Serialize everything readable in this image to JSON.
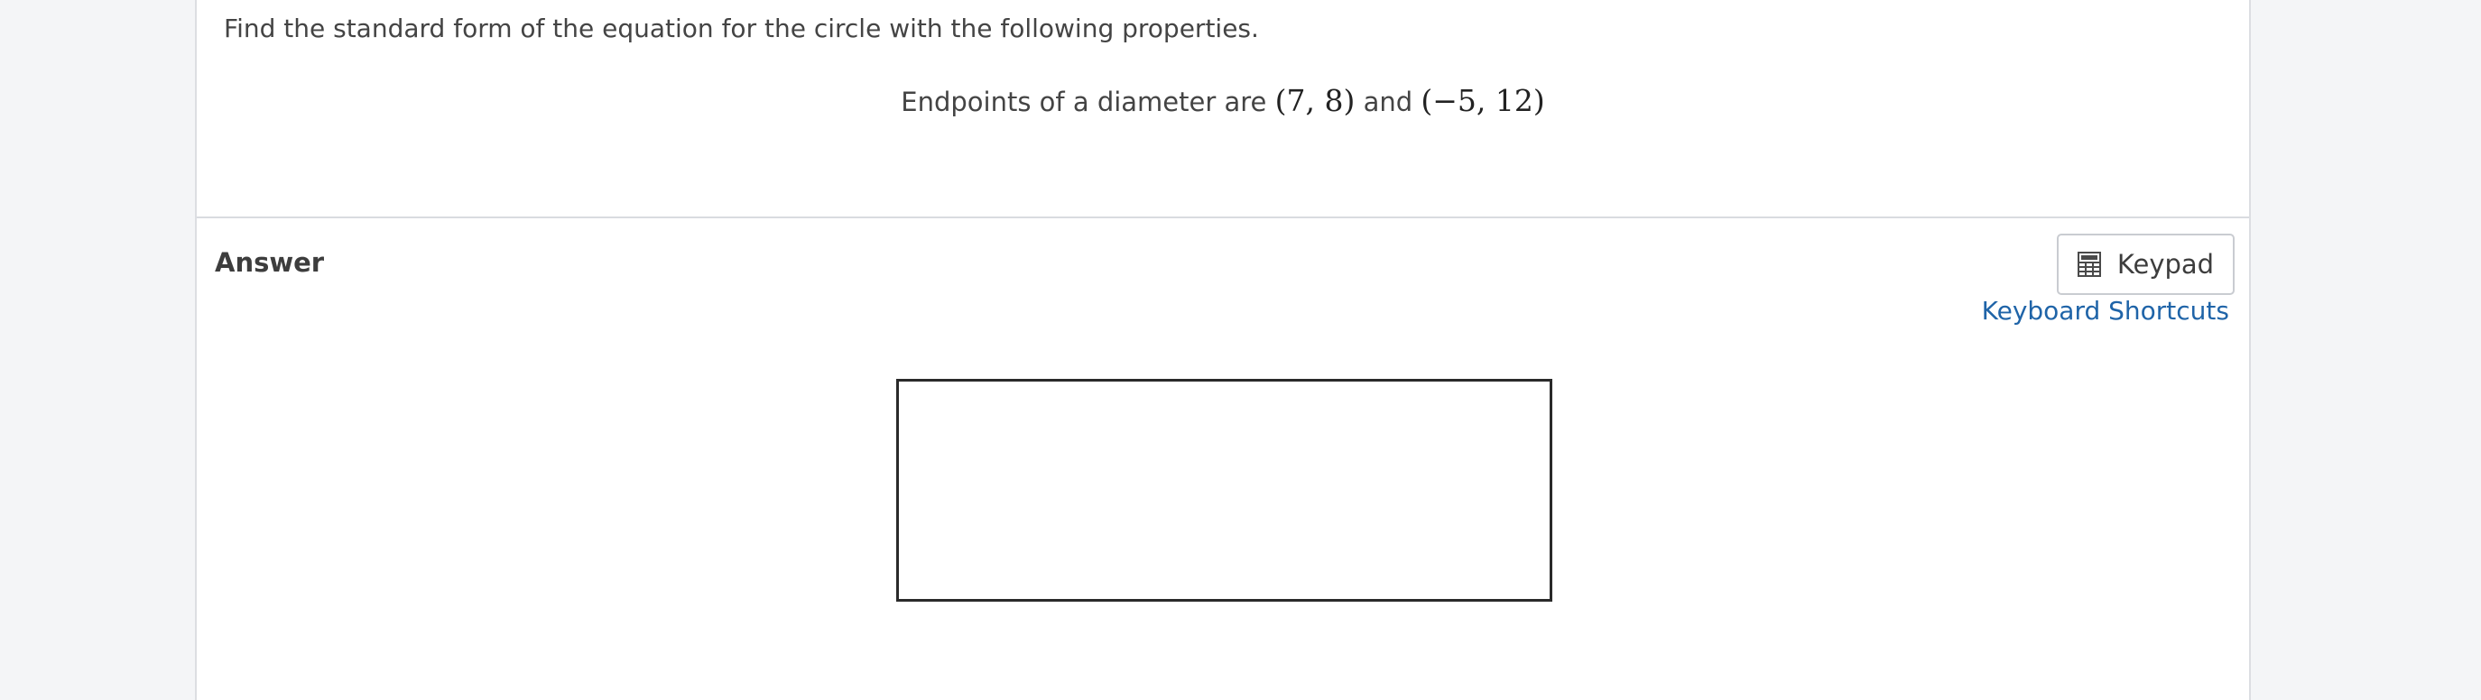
{
  "question": {
    "prompt": "Find the standard form of the equation for the circle with the following properties.",
    "given_prefix": "Endpoints of a diameter are",
    "point_a": "(7, 8)",
    "conjunction": "and",
    "point_b": "(−5, 12)"
  },
  "answer": {
    "label": "Answer",
    "keypad_label": "Keypad",
    "keypad_icon": "calculator-icon",
    "shortcuts_label": "Keyboard Shortcuts",
    "input_value": ""
  },
  "colors": {
    "link": "#1f64a8",
    "page_background": "#f4f5f7",
    "card_background": "#ffffff"
  }
}
